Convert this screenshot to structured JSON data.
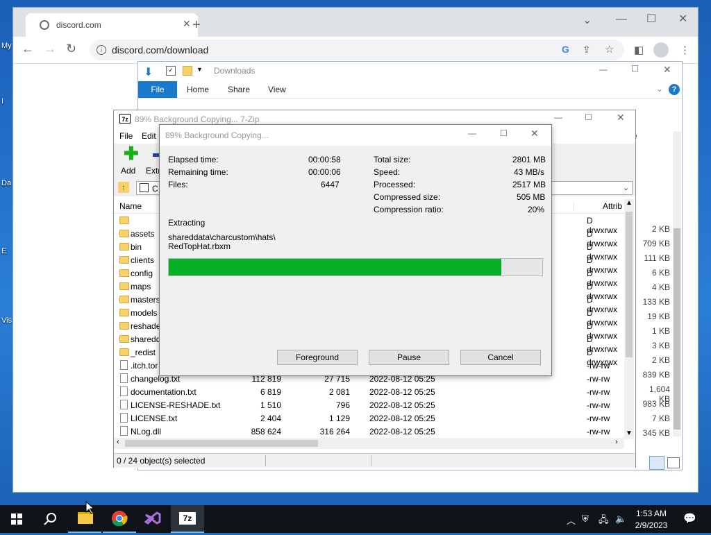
{
  "desktop": {
    "icon_labels": [
      "My",
      "I",
      "Da",
      "E",
      "Vis"
    ]
  },
  "browser": {
    "tab_title": "discord.com",
    "url": "discord.com/download"
  },
  "explorer": {
    "title": "Downloads",
    "ribbon_tabs": [
      "File",
      "Home",
      "Share",
      "View"
    ],
    "side_sizes": [
      "2 KB",
      "709 KB",
      "111 KB",
      "6 KB",
      "4 KB",
      "133 KB",
      "19 KB",
      "1 KB",
      "3 KB",
      "2 KB",
      "839 KB",
      "1,604 KB",
      "983 KB",
      "7 KB",
      "345 KB"
    ],
    "side_col_fragment": "e"
  },
  "sevenzip": {
    "title": "89% Background Copying... 7-Zip",
    "menu": [
      "File",
      "Edit"
    ],
    "toolbar": {
      "add": "Add",
      "extract": "Extr"
    },
    "addr_fragment": "C",
    "columns": {
      "name": "Name",
      "attrib": "Attrib"
    },
    "rows": [
      {
        "type": "folder",
        "name": "",
        "size": "",
        "packed": "",
        "modified": "",
        "attr": "D drwxrwx"
      },
      {
        "type": "folder",
        "name": "assets",
        "size": "",
        "packed": "",
        "modified": "",
        "attr": "D drwxrwx"
      },
      {
        "type": "folder",
        "name": "bin",
        "size": "",
        "packed": "",
        "modified": "",
        "attr": "D drwxrwx"
      },
      {
        "type": "folder",
        "name": "clients",
        "size": "",
        "packed": "",
        "modified": "",
        "attr": "D drwxrwx"
      },
      {
        "type": "folder",
        "name": "config",
        "size": "",
        "packed": "",
        "modified": "",
        "attr": "D drwxrwx"
      },
      {
        "type": "folder",
        "name": "maps",
        "size": "",
        "packed": "",
        "modified": "",
        "attr": "D drwxrwx"
      },
      {
        "type": "folder",
        "name": "masters",
        "size": "",
        "packed": "",
        "modified": "",
        "attr": "D drwxrwx"
      },
      {
        "type": "folder",
        "name": "models",
        "size": "",
        "packed": "",
        "modified": "",
        "attr": "D drwxrwx"
      },
      {
        "type": "folder",
        "name": "reshade",
        "size": "",
        "packed": "",
        "modified": "",
        "attr": "D drwxrwx"
      },
      {
        "type": "folder",
        "name": "sharedd",
        "size": "",
        "packed": "",
        "modified": "",
        "attr": "D drwxrwx"
      },
      {
        "type": "folder",
        "name": "_redist",
        "size": "",
        "packed": "",
        "modified": "",
        "attr": "D drwxrwx"
      },
      {
        "type": "file",
        "name": ".itch.tor",
        "size": "",
        "packed": "",
        "modified": "",
        "attr": "-rw-rw"
      },
      {
        "type": "file",
        "name": "changelog.txt",
        "size": "112 819",
        "packed": "27 715",
        "modified": "2022-08-12 05:25",
        "attr": "-rw-rw"
      },
      {
        "type": "file",
        "name": "documentation.txt",
        "size": "6 819",
        "packed": "2 081",
        "modified": "2022-08-12 05:25",
        "attr": "-rw-rw"
      },
      {
        "type": "file",
        "name": "LICENSE-RESHADE.txt",
        "size": "1 510",
        "packed": "796",
        "modified": "2022-08-12 05:25",
        "attr": "-rw-rw"
      },
      {
        "type": "file",
        "name": "LICENSE.txt",
        "size": "2 404",
        "packed": "1 129",
        "modified": "2022-08-12 05:25",
        "attr": "-rw-rw"
      },
      {
        "type": "file",
        "name": "NLog.dll",
        "size": "858 624",
        "packed": "316 264",
        "modified": "2022-08-12 05:25",
        "attr": "-rw-rw"
      }
    ],
    "status": "0 / 24 object(s) selected"
  },
  "dialog": {
    "title": "89% Background Copying...",
    "left_stats": [
      {
        "label": "Elapsed time:",
        "value": "00:00:58"
      },
      {
        "label": "Remaining time:",
        "value": "00:00:06"
      },
      {
        "label": "Files:",
        "value": "6447"
      }
    ],
    "right_stats": [
      {
        "label": "Total size:",
        "value": "2801 MB"
      },
      {
        "label": "Speed:",
        "value": "43 MB/s"
      },
      {
        "label": "Processed:",
        "value": "2517 MB"
      },
      {
        "label": "Compressed size:",
        "value": "505 MB"
      },
      {
        "label": "Compression ratio:",
        "value": "20%"
      }
    ],
    "action": "Extracting",
    "path_line1": "shareddata\\charcustom\\hats\\",
    "path_line2": "RedTopHat.rbxm",
    "progress": 0.89,
    "buttons": {
      "foreground": "Foreground",
      "pause": "Pause",
      "cancel": "Cancel"
    }
  },
  "taskbar": {
    "time": "1:53 AM",
    "date": "2/9/2023",
    "sevenzip_icon": "7z"
  },
  "colors": {
    "progress": "#06b025",
    "ribbon_file": "#1979ca",
    "taskbar": "#101418"
  }
}
